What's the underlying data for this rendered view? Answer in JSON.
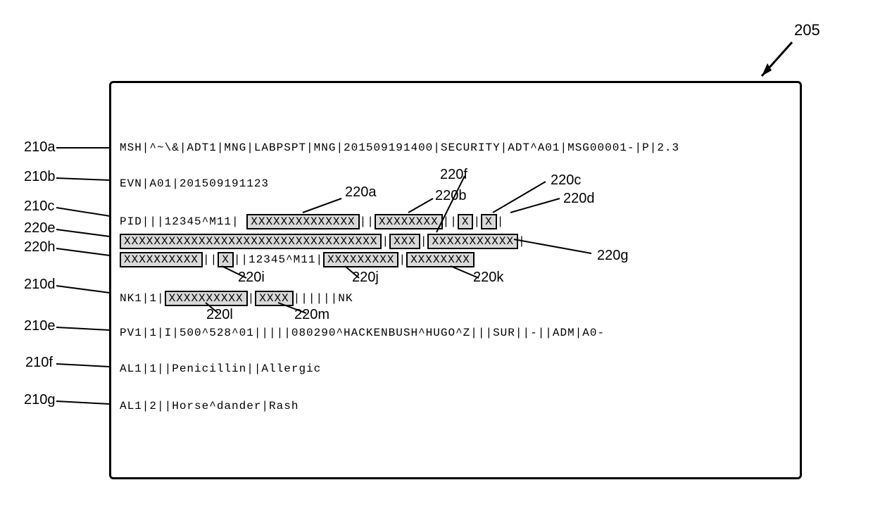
{
  "figure_ref": "205",
  "row_labels": [
    "210a",
    "210b",
    "210c",
    "220e",
    "220h",
    "210d",
    "210e",
    "210f",
    "210g"
  ],
  "box_labels": {
    "a": "220a",
    "b": "220b",
    "c": "220c",
    "d": "220d",
    "e": "220e",
    "f": "220f",
    "g": "220g",
    "h": "220h",
    "i": "220i",
    "j": "220j",
    "k": "220k",
    "l": "220l",
    "m": "220m"
  },
  "segments": {
    "msh": "MSH|^~\\&|ADT1|MNG|LABPSPT|MNG|201509191400|SECURITY|ADT^A01|MSG00001-|P|2.3",
    "evn": "EVN|A01|201509191123",
    "pid_pre": "PID|||12345^M11|",
    "pid_220a": "XXXXXXXXXXXXXX",
    "pid_sep1": "||",
    "pid_220b": "XXXXXXXX",
    "pid_sep2": "||",
    "pid_220c": "X",
    "pid_sep3": "|",
    "pid_220d": "X",
    "pid_sep4": "|",
    "e_220e": "XXXXXXXXXXXXXXXXXXXXXXXXXXXXXXXXXX",
    "e_sep1": "|",
    "e_220f": "XXX",
    "e_sep2": "|",
    "e_220g": "XXXXXXXXXXX",
    "e_sep3": "|",
    "h_220h": "XXXXXXXXXX",
    "h_sep1": "||",
    "h_220i": "X",
    "h_sep2": "||12345^M11|",
    "h_220j": "XXXXXXXXX",
    "h_sep3": "|",
    "h_220k": "XXXXXXXX",
    "nk_pre": "NK1|1|",
    "nk_220l": "XXXXXXXXXX",
    "nk_sep1": "|",
    "nk_220m": "XXXX",
    "nk_post": "||||||NK",
    "pv1": "PV1|1|I|500^528^01|||||080290^HACKENBUSH^HUGO^Z|||SUR||-||ADM|A0-",
    "al1a": "AL1|1||Penicillin||Allergic",
    "al1b": "AL1|2||Horse^dander|Rash"
  }
}
